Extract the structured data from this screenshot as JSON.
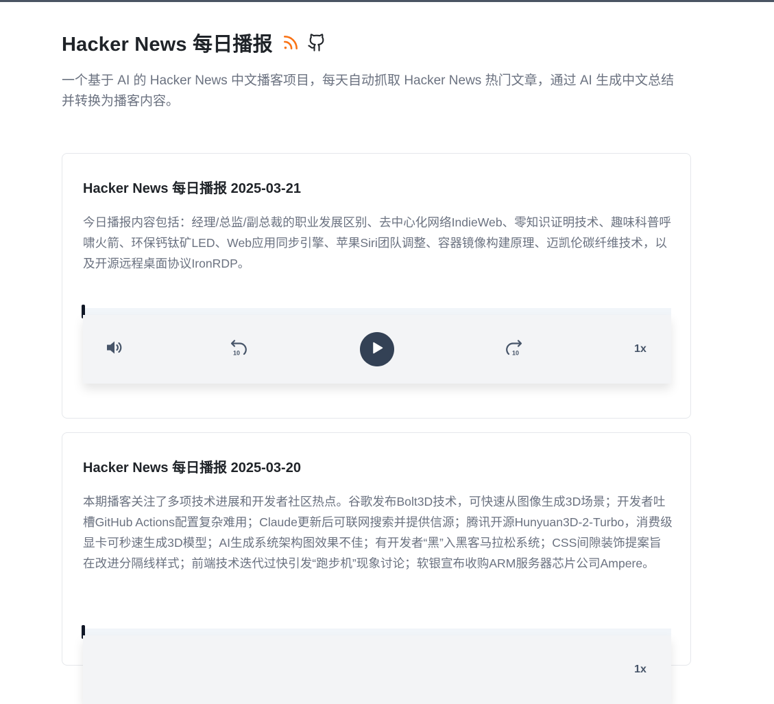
{
  "header": {
    "title": "Hacker News 每日播报",
    "description": "一个基于 AI 的 Hacker News 中文播客项目，每天自动抓取 Hacker News 热门文章，通过 AI 生成中文总结并转换为播客内容。",
    "icons": [
      "rss-icon",
      "github-icon"
    ]
  },
  "colors": {
    "rss_accent": "#f97316",
    "player_button": "#334155"
  },
  "episodes": [
    {
      "title": "Hacker News 每日播报 2025-03-21",
      "summary": "今日播报内容包括：经理/总监/副总裁的职业发展区别、去中心化网络IndieWeb、零知识证明技术、趣味科普呼啸火箭、环保钙钛矿LED、Web应用同步引擎、苹果Siri团队调整、容器镜像构建原理、迈凯伦碳纤维技术，以及开源远程桌面协议IronRDP。",
      "player": {
        "progress": 0,
        "speed_label": "1x",
        "icons": [
          "volume-icon",
          "rewind-10-icon",
          "play-icon",
          "forward-10-icon"
        ]
      }
    },
    {
      "title": "Hacker News 每日播报 2025-03-20",
      "summary": "本期播客关注了多项技术进展和开发者社区热点。谷歌发布Bolt3D技术，可快速从图像生成3D场景；开发者吐槽GitHub Actions配置复杂难用；Claude更新后可联网搜索并提供信源；腾讯开源Hunyuan3D-2-Turbo，消费级显卡可秒速生成3D模型；AI生成系统架构图效果不佳；有开发者“黑”入黑客马拉松系统；CSS间隙装饰提案旨在改进分隔线样式；前端技术迭代过快引发“跑步机”现象讨论；软银宣布收购ARM服务器芯片公司Ampere。",
      "player": {
        "progress": 0,
        "speed_label": "1x"
      }
    }
  ]
}
